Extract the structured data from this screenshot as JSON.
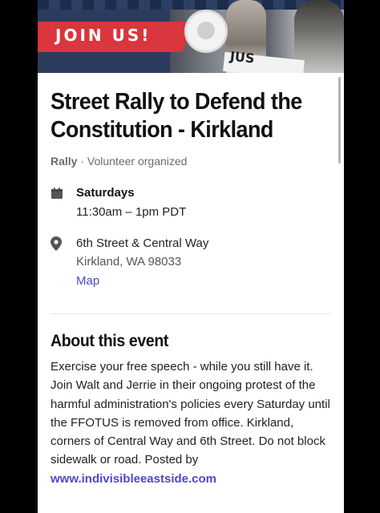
{
  "hero": {
    "banner_text": "JOIN US!",
    "sign_text": "JUS"
  },
  "event": {
    "title": "Street Rally to Defend the Constitution - Kirkland",
    "type": "Rally",
    "separator": " · ",
    "organizer": "Volunteer organized"
  },
  "schedule": {
    "day": "Saturdays",
    "time": "11:30am – 1pm PDT",
    "icon": "calendar-icon"
  },
  "location": {
    "street": "6th Street & Central Way",
    "city": "Kirkland, WA 98033",
    "map_label": "Map",
    "icon": "location-pin-icon"
  },
  "about": {
    "heading": "About this event",
    "description": "Exercise your free speech - while you still have it. Join Walt and Jerrie in their ongoing protest of the harmful administration's policies every Saturday until the FFOTUS is removed from office. Kirkland, corners of Central Way and 6th Street. Do not block sidewalk or road. Posted by",
    "link": "www.indivisibleeastside.com"
  },
  "colors": {
    "link": "#4b48c8",
    "banner_red": "#d9363e",
    "banner_navy": "#2b3b5e"
  }
}
